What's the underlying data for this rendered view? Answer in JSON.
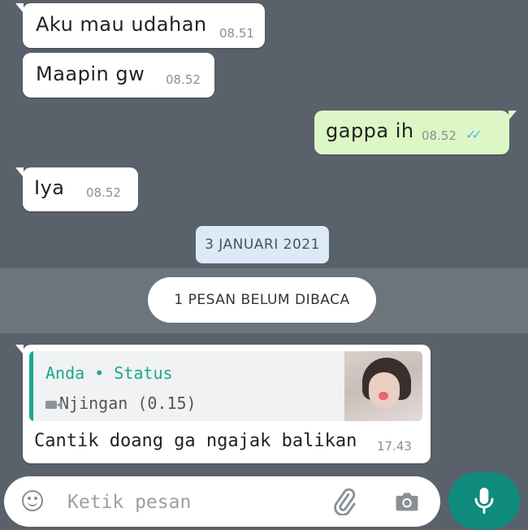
{
  "messages": [
    {
      "text": "Aku mau udahan",
      "time": "08.51"
    },
    {
      "text": "Maapin gw",
      "time": "08.52"
    },
    {
      "text": "gappa ih",
      "time": "08.52",
      "ticks": "✓✓"
    },
    {
      "text": "Iya",
      "time": "08.52"
    }
  ],
  "date_chip": "3 JANUARI 2021",
  "unread_label": "1 PESAN BELUM DIBACA",
  "reply_message": {
    "quote_author": "Anda • Status",
    "quote_text": "Njingan (0.15)",
    "text": "Cantik doang ga ngajak balikan",
    "time": "17.43"
  },
  "composer": {
    "placeholder": "Ketik pesan"
  },
  "colors": {
    "background": "#59616b",
    "outgoing_bubble": "#dcf7c5",
    "accent": "#0f8b7e",
    "quote_accent": "#1aa890",
    "read_ticks": "#4fb6ec"
  },
  "icons": [
    "emoji-icon",
    "attach-icon",
    "camera-icon",
    "mic-icon",
    "video-icon",
    "double-check-icon"
  ]
}
